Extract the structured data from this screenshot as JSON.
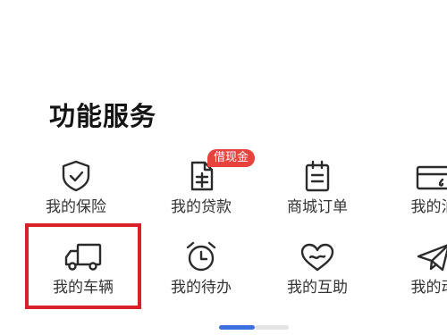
{
  "section": {
    "title": "功能服务"
  },
  "services_row1": [
    {
      "label": "我的保险",
      "icon": "shield-check-icon"
    },
    {
      "label": "我的贷款",
      "icon": "loan-document-icon",
      "badge": "借现金"
    },
    {
      "label": "商城订单",
      "icon": "clipboard-list-icon"
    },
    {
      "label": "我的油",
      "icon": "fuel-card-icon"
    }
  ],
  "services_row2": [
    {
      "label": "我的车辆",
      "icon": "truck-icon",
      "highlighted": true
    },
    {
      "label": "我的待办",
      "icon": "alarm-clock-icon"
    },
    {
      "label": "我的互助",
      "icon": "heart-icon"
    },
    {
      "label": "我的动",
      "icon": "paper-plane-icon"
    }
  ],
  "pager": {
    "pages": 2,
    "current": 1
  },
  "colors": {
    "badge": "#e8423c",
    "highlight_border": "#d6202a",
    "pager_active": "#3d6fe0",
    "pager_inactive": "#e4e4e4",
    "icon_stroke": "#2b2b2b"
  }
}
